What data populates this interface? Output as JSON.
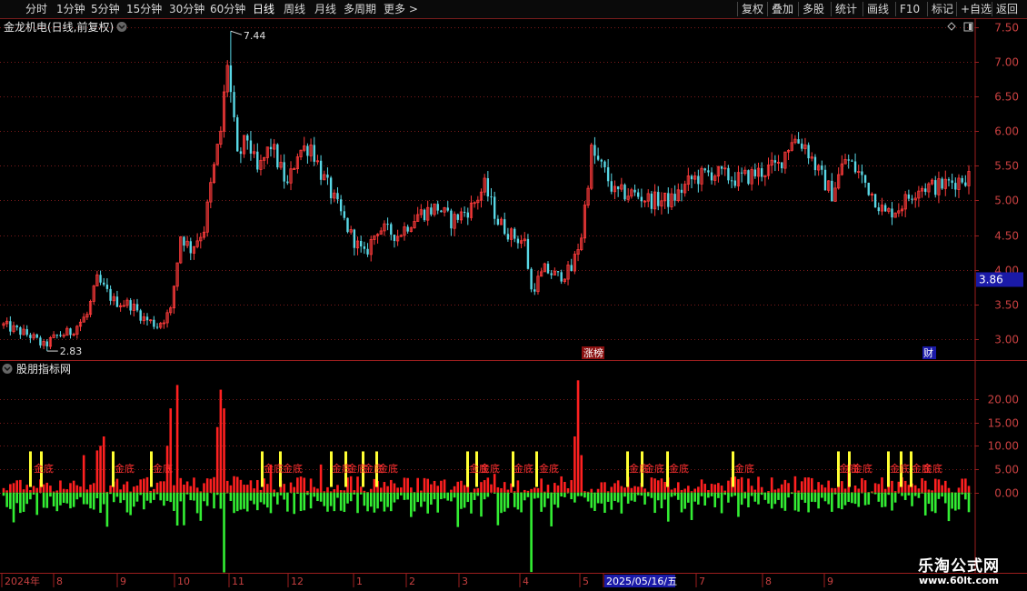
{
  "toolbar": {
    "left_items": [
      "分时",
      "1分钟",
      "5分钟",
      "15分钟",
      "30分钟",
      "60分钟",
      "日线",
      "周线",
      "月线",
      "多周期",
      "更多 >"
    ],
    "active": "日线",
    "right_items": [
      "复权",
      "叠加",
      "多股",
      "统计",
      "画线",
      "F10",
      "标记",
      "+自选",
      "返回"
    ]
  },
  "main_panel": {
    "title": "金龙机电(日线,前复权)",
    "high_label": "7.44",
    "low_label": "2.83",
    "current_price_label": "3.86",
    "event_tags": [
      "涨榜",
      "财"
    ],
    "y_ticks": [
      "7.50",
      "7.00",
      "6.50",
      "6.00",
      "5.50",
      "5.00",
      "4.50",
      "4.00",
      "3.50",
      "3.00"
    ]
  },
  "indicator_panel": {
    "title": "股朋指标网",
    "signal_label": "金底",
    "y_ticks": [
      "20.00",
      "15.00",
      "10.00",
      "5.00",
      "0.00"
    ]
  },
  "date_axis": {
    "labels": [
      "2024年",
      "8",
      "9",
      "10",
      "11",
      "12",
      "1",
      "2",
      "3",
      "4",
      "5",
      "2025/05/16/五",
      "7",
      "8",
      "9"
    ]
  },
  "watermark": {
    "title": "乐淘公式网",
    "url": "www.60lt.com"
  },
  "colors": {
    "up": "#ff3b3b",
    "down": "#59d8e6",
    "indicator_pos": "#ff2020",
    "indicator_neg": "#33ee33",
    "signal": "#ffff33",
    "axis": "#9b1e1e"
  },
  "chart_data": {
    "type": "candlestick",
    "price_range": [
      2.7,
      7.6
    ],
    "price_high": 7.44,
    "price_low": 2.83,
    "current_price": 3.86,
    "indicator_range": [
      -16,
      26
    ]
  }
}
